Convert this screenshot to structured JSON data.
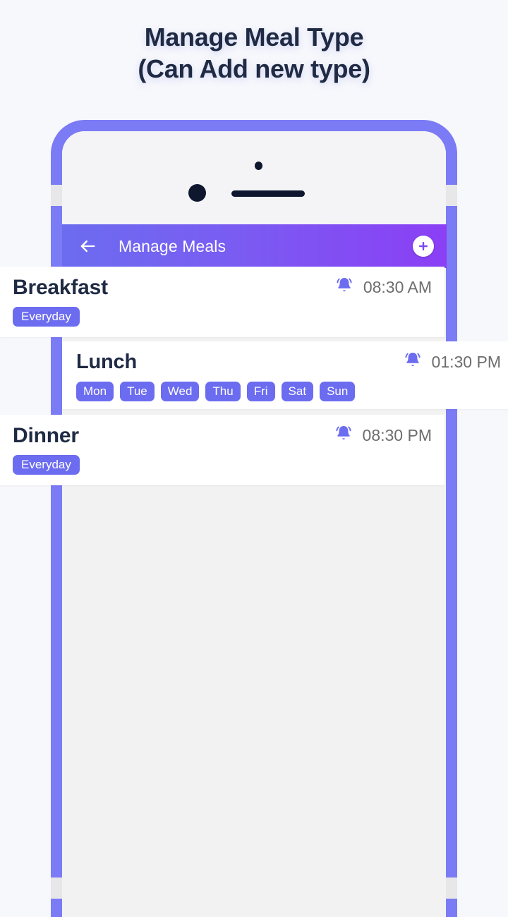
{
  "heading": {
    "line1": "Manage Meal Type",
    "line2": "(Can Add new type)"
  },
  "appbar": {
    "title": "Manage Meals",
    "back_icon": "arrow-left-icon",
    "add_icon": "plus-icon",
    "gradient_start": "#6c6cf0",
    "gradient_end": "#8b3ff5"
  },
  "colors": {
    "accent": "#6c6cf0",
    "frame": "#7b7bf5",
    "title_text": "#1f2a44",
    "time_text": "#6d6d6d",
    "page_bg": "#f7f8fc",
    "screen_bg": "#f2f2f2"
  },
  "meals": [
    {
      "name": "Breakfast",
      "time": "08:30 AM",
      "alarm_icon": "bell-icon",
      "chips": [
        "Everyday"
      ]
    },
    {
      "name": "Lunch",
      "time": "01:30 PM",
      "alarm_icon": "bell-icon",
      "chips": [
        "Mon",
        "Tue",
        "Wed",
        "Thu",
        "Fri",
        "Sat",
        "Sun"
      ]
    },
    {
      "name": "Dinner",
      "time": "08:30 PM",
      "alarm_icon": "bell-icon",
      "chips": [
        "Everyday"
      ]
    }
  ]
}
